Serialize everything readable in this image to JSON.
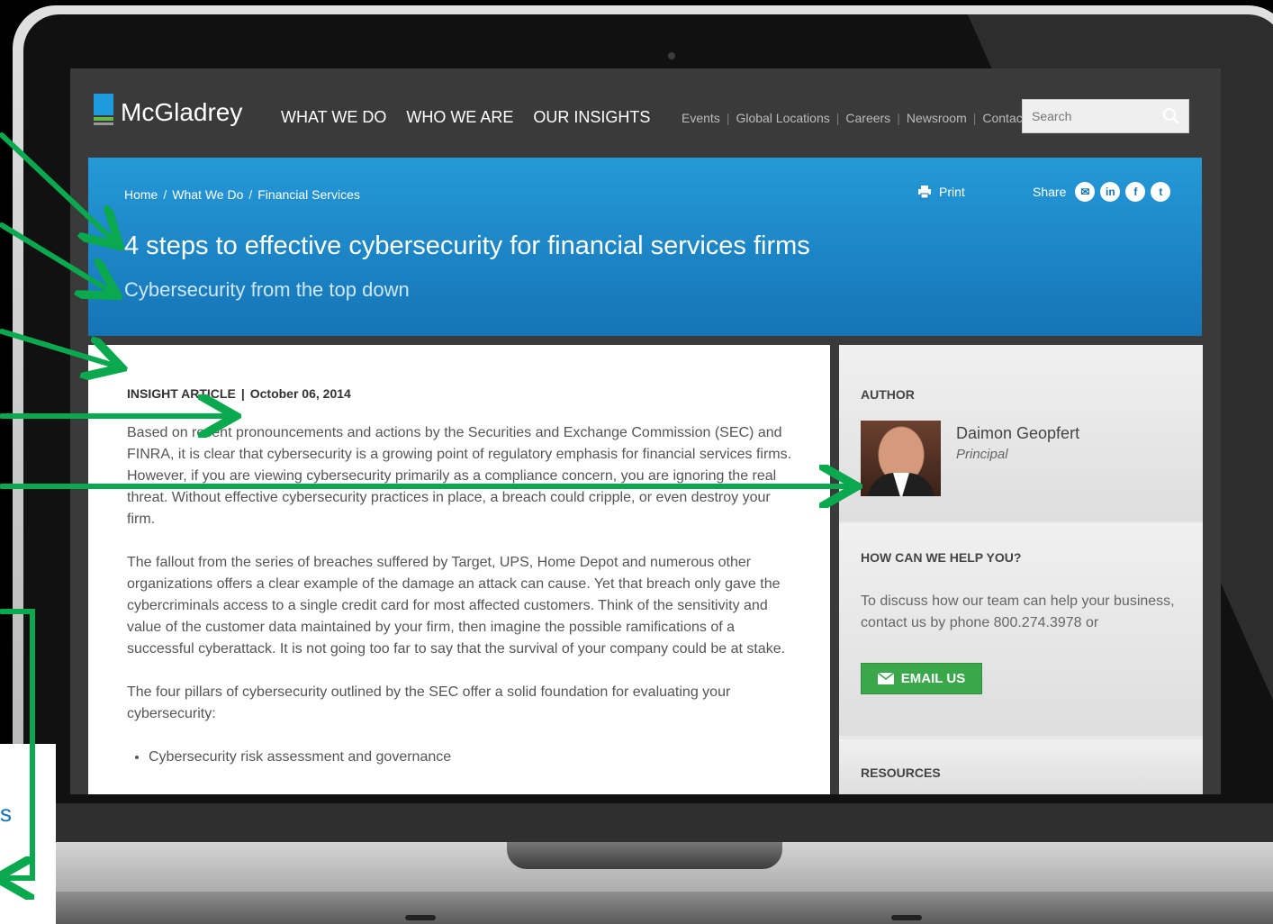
{
  "site": {
    "logo_text": "McGladrey",
    "main_nav": [
      "WHAT WE DO",
      "WHO WE ARE",
      "OUR INSIGHTS"
    ],
    "util_nav": [
      "Events",
      "Global Locations",
      "Careers",
      "Newsroom",
      "Contact"
    ],
    "search_placeholder": "Search"
  },
  "hero": {
    "breadcrumb": [
      "Home",
      "What We Do",
      "Financial Services"
    ],
    "breadcrumb_sep": "/",
    "print_label": "Print",
    "share_label": "Share",
    "share_icons": [
      "email-icon",
      "linkedin-icon",
      "facebook-icon",
      "twitter-icon"
    ],
    "title": "4 steps to effective cybersecurity for financial services firms",
    "subtitle": "Cybersecurity from the top down"
  },
  "article": {
    "type": "INSIGHT ARTICLE",
    "date": "October 06, 2014",
    "paragraphs": [
      "Based on recent pronouncements and actions by the Securities and Exchange Commission (SEC) and FINRA, it is clear that cybersecurity is a growing point of regulatory emphasis for financial services firms. However, if you are viewing cybersecurity primarily as a compliance concern, you are ignoring the real threat. Without effective cybersecurity practices in place, a breach could cripple, or even destroy your firm.",
      "The fallout from the series of breaches suffered by Target, UPS, Home Depot and numerous other organizations offers a clear example of the damage an attack can cause. Yet that breach only gave the cybercriminals access to a single credit card for most affected customers. Think of the sensitivity and value of the customer data maintained by your firm, then imagine the possible ramifications of a successful cyberattack. It is not going too far to say that the survival of your company could be at stake.",
      "The four pillars of cybersecurity outlined by the SEC offer a solid foundation for evaluating your cybersecurity:"
    ],
    "bullets": [
      "Cybersecurity risk assessment and governance"
    ]
  },
  "sidebar": {
    "author_heading": "AUTHOR",
    "author_name": "Daimon Geopfert",
    "author_role": "Principal",
    "help_heading": "HOW CAN WE HELP YOU?",
    "help_text": "To discuss how our team can help your business, contact us by phone 800.274.3978 or",
    "email_button": "EMAIL US",
    "resources_heading": "RESOURCES"
  },
  "overlay": {
    "arrow_color": "#0aa84f",
    "callout_partial_text": "s"
  }
}
